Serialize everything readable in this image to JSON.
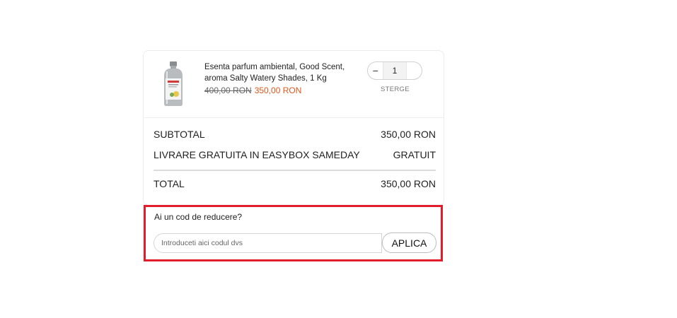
{
  "cart": {
    "product": {
      "name": "Esenta parfum ambiental, Good Scent, aroma Salty Watery Shades, 1 Kg",
      "old_price": "400,00 RON",
      "new_price": "350,00 RON",
      "image_icon": "perfume-bottle-image"
    },
    "quantity": {
      "minus_label": "−",
      "value": "1",
      "plus_label": ""
    },
    "remove_label": "STERGE",
    "subtotal": {
      "label": "SUBTOTAL",
      "value": "350,00 RON"
    },
    "shipping": {
      "label": "LIVRARE GRATUITA IN EASYBOX SAMEDAY",
      "value": "GRATUIT"
    },
    "total": {
      "label": "TOTAL",
      "value": "350,00 RON"
    }
  },
  "discount": {
    "question": "Ai un cod de reducere?",
    "placeholder": "Introduceti aici codul dvs",
    "apply_label": "APLICA",
    "highlight_color": "#e21c2a"
  },
  "colors": {
    "sale_price": "#e0571c"
  }
}
